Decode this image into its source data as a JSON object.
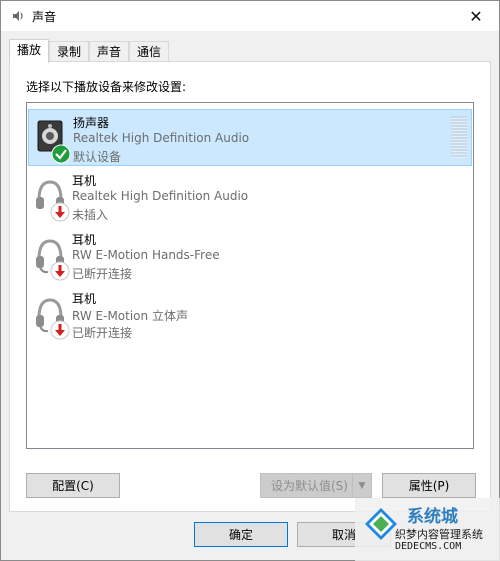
{
  "window": {
    "title": "声音",
    "close_glyph": "✕"
  },
  "tabs": [
    {
      "label": "播放",
      "active": true
    },
    {
      "label": "录制",
      "active": false
    },
    {
      "label": "声音",
      "active": false
    },
    {
      "label": "通信",
      "active": false
    }
  ],
  "panel": {
    "instruction": "选择以下播放设备来修改设置:"
  },
  "devices": [
    {
      "name": "扬声器",
      "description": "Realtek High Definition Audio",
      "status": "默认设备",
      "icon": "speaker-icon",
      "badge": "default-check-icon",
      "selected": true
    },
    {
      "name": "耳机",
      "description": "Realtek High Definition Audio",
      "status": "未插入",
      "icon": "headphones-icon",
      "badge": "unplugged-arrow-icon",
      "selected": false
    },
    {
      "name": "耳机",
      "description": "RW E-Motion Hands-Free",
      "status": "已断开连接",
      "icon": "headset-icon",
      "badge": "disconnected-arrow-icon",
      "selected": false
    },
    {
      "name": "耳机",
      "description": "RW E-Motion 立体声",
      "status": "已断开连接",
      "icon": "headset-icon",
      "badge": "disconnected-arrow-icon",
      "selected": false
    }
  ],
  "buttons": {
    "configure": "配置(C)",
    "set_default": "设为默认值(S)",
    "set_default_arrow": "▼",
    "properties": "属性(P)",
    "ok": "确定",
    "cancel": "取消"
  },
  "watermark": {
    "brand": "系统城",
    "sub": "织梦内容管理系统",
    "url": "DEDECMS.COM"
  },
  "colors": {
    "selection_bg": "#cce8ff",
    "selection_border": "#99d1ff",
    "check_green": "#1f9d3a",
    "arrow_red": "#d42020"
  }
}
